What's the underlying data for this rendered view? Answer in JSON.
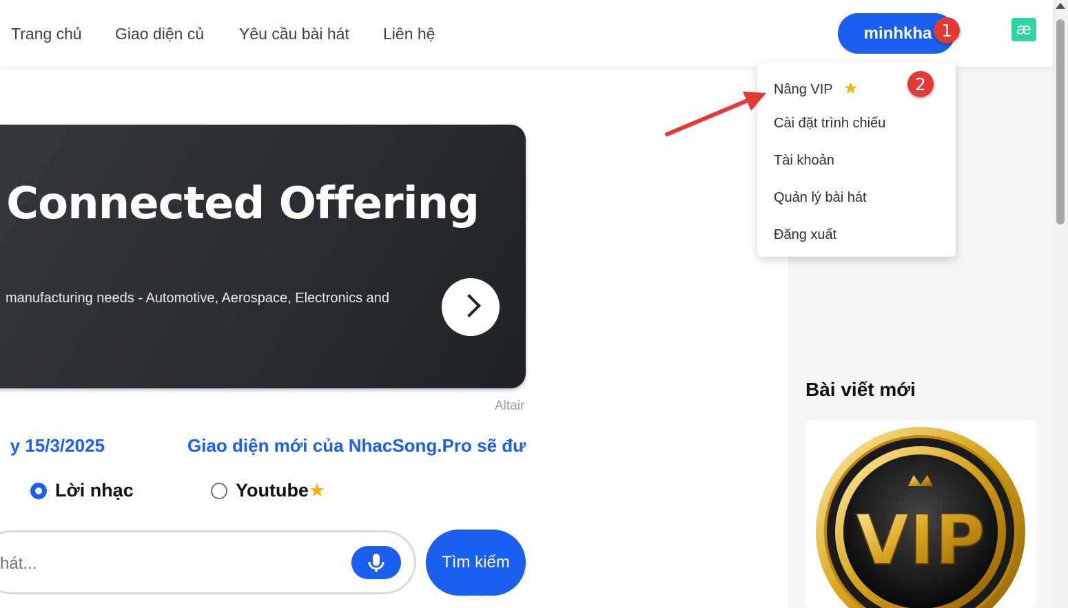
{
  "nav": {
    "links": [
      "Trang chủ",
      "Giao diện củ",
      "Yêu cầu bài hát",
      "Liên hệ"
    ],
    "user_label": "minhkha",
    "badge_1": "1",
    "badge_2": "2"
  },
  "dropdown": {
    "items": [
      "Nâng VIP",
      "Cài đặt trình chiếu",
      "Tài khoản",
      "Quản lý bài hát",
      "Đăng xuất"
    ],
    "vip_star": "★"
  },
  "banner": {
    "title": "ne, Connected Offering",
    "subtitle": "manufacturing needs - Automotive, Aerospace, Electronics and",
    "caption": "Altair"
  },
  "announcements": {
    "left": "y 15/3/2025",
    "right": "Giao diện mới của NhacSong.Pro sẽ đư"
  },
  "search_mode": {
    "options": [
      "Lời nhạc",
      "Youtube"
    ],
    "selected": "Lời nhạc",
    "youtube_star": "★"
  },
  "search": {
    "placeholder": "hát...",
    "button_label": "Tìm kiếm"
  },
  "sidebar": {
    "title": "Bài viết mới",
    "card_image_text": "VIP"
  },
  "icons": {
    "extension": "æ",
    "mic": "mic-icon",
    "next": "chevron-right-icon"
  },
  "colors": {
    "primary": "#1a5ff0",
    "badge": "#e53935",
    "star": "#f5b301",
    "annotation_arrow": "#e53935"
  }
}
